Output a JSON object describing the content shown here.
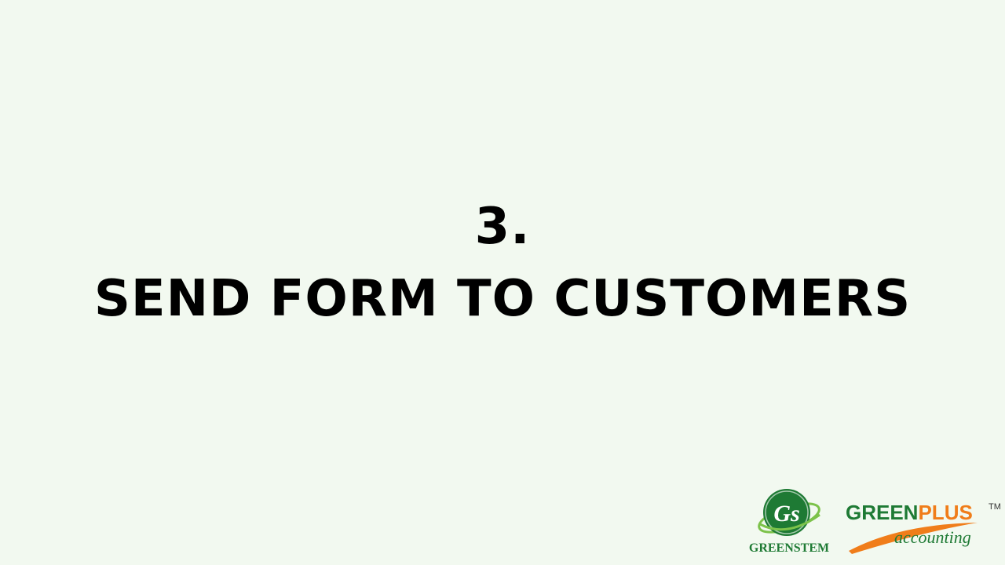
{
  "slide": {
    "number": "3.",
    "title": "SEND FORM TO CUSTOMERS"
  },
  "logos": {
    "greenstem": {
      "monogram": "Gs",
      "name": "GREENSTEM"
    },
    "greenplus": {
      "word_green": "GREEN",
      "word_orange": "PLUS",
      "trademark": "TM",
      "subtitle": "accounting"
    }
  },
  "colors": {
    "background": "#f2f9f0",
    "title_text": "#000000",
    "brand_green": "#1e7a34",
    "brand_orange": "#f07d1a"
  }
}
